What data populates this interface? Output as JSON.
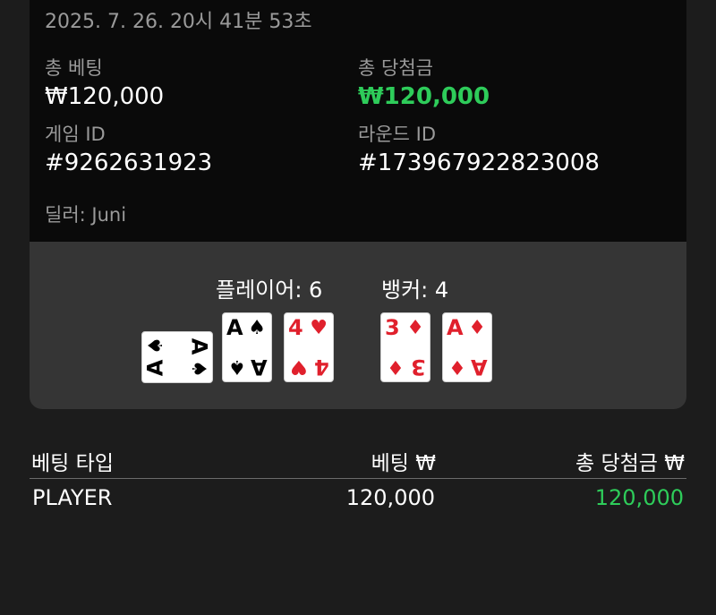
{
  "round": {
    "datetime": "2025. 7. 26. 20시 41분 53초",
    "total_bet_label": "총 베팅",
    "total_bet_value": "₩120,000",
    "total_win_label": "총 당첨금",
    "total_win_value": "₩120,000",
    "game_id_label": "게임 ID",
    "game_id_value": "#9262631923",
    "round_id_label": "라운드 ID",
    "round_id_value": "#173967922823008",
    "dealer": "딜러: Juni"
  },
  "cards": {
    "player_label": "플레이어: 6",
    "banker_label": "뱅커: 4",
    "player_cards": [
      {
        "rank": "A",
        "suit": "♠",
        "color": "#000000",
        "orientation": "sideways"
      },
      {
        "rank": "A",
        "suit": "♠",
        "color": "#000000",
        "orientation": "upright"
      },
      {
        "rank": "4",
        "suit": "♥",
        "color": "#e0202c",
        "orientation": "upright"
      }
    ],
    "banker_cards": [
      {
        "rank": "3",
        "suit": "♦",
        "color": "#e0202c",
        "orientation": "upright"
      },
      {
        "rank": "A",
        "suit": "♦",
        "color": "#e0202c",
        "orientation": "upright"
      }
    ]
  },
  "bets_table": {
    "headers": [
      "베팅 타입",
      "베팅 ₩",
      "총 당첨금 ₩"
    ],
    "rows": [
      {
        "type": "PLAYER",
        "bet": "120,000",
        "win": "120,000"
      }
    ]
  },
  "colors": {
    "win_green": "#2ecc5a",
    "panel_dark": "#0a0a0a",
    "panel_gray": "#353535",
    "background": "#1c1c1c"
  }
}
